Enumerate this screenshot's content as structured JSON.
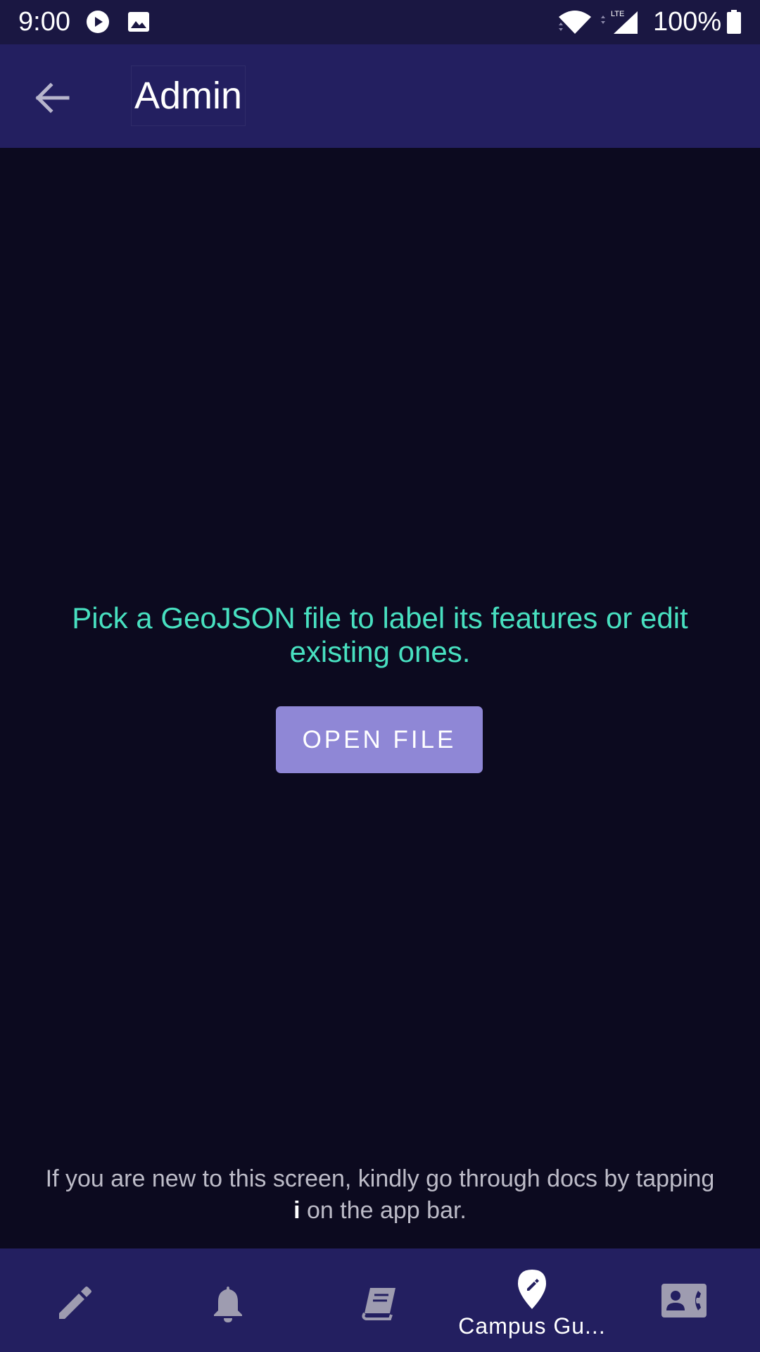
{
  "status_bar": {
    "time": "9:00",
    "battery": "100%",
    "icons": [
      "play-icon",
      "image-icon",
      "wifi-icon",
      "lte-signal-icon",
      "battery-icon"
    ]
  },
  "app_bar": {
    "title": "Admin",
    "back_icon": "arrow-back-icon"
  },
  "main": {
    "message": "Pick a GeoJSON file to label its features or edit existing ones.",
    "open_button_label": "OPEN FILE"
  },
  "hint": {
    "before": "If you are new to this screen, kindly go through docs by tapping ",
    "emphasis": "i",
    "after": " on the app bar."
  },
  "bottom_nav": {
    "items": [
      {
        "icon": "pencil-icon",
        "label": "",
        "active": false
      },
      {
        "icon": "bell-icon",
        "label": "",
        "active": false
      },
      {
        "icon": "book-icon",
        "label": "",
        "active": false
      },
      {
        "icon": "map-pin-edit-icon",
        "label": "Campus Gu...",
        "active": true
      },
      {
        "icon": "contact-phone-icon",
        "label": "",
        "active": false
      }
    ]
  },
  "colors": {
    "background": "#0c0a1f",
    "app_bar": "#231f60",
    "status_bar": "#1a1742",
    "accent_text": "#48e0c0",
    "button": "#8f87d6",
    "inactive_icon": "#9e9cb0"
  }
}
